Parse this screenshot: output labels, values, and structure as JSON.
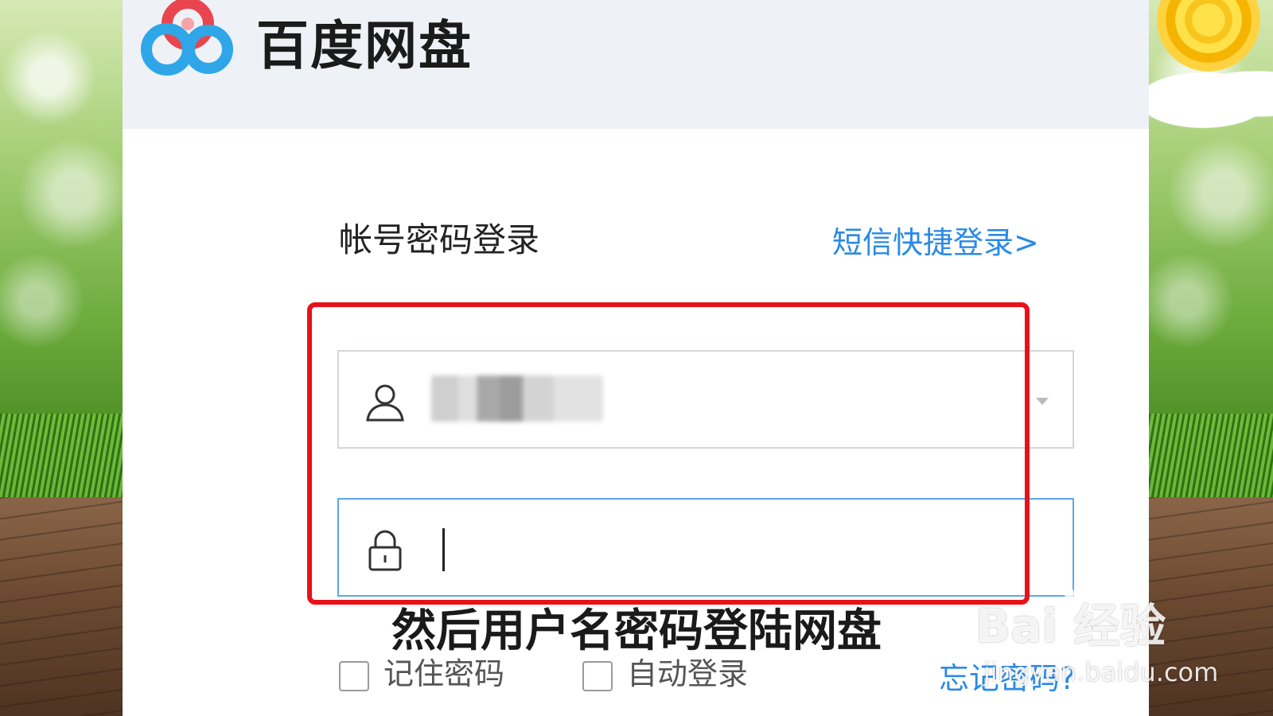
{
  "app": {
    "name": "百度网盘"
  },
  "login": {
    "title": "帐号密码登录",
    "sms_link": "短信快捷登录>",
    "username_field": {
      "value_redacted": true
    },
    "password_field": {
      "value": ""
    },
    "remember_label": "记住密码",
    "autologin_label": "自动登录",
    "forgot_link": "忘记密码?"
  },
  "annotation": {
    "subtitle": "然后用户名密码登陆网盘",
    "highlight_color": "#e8111a"
  },
  "watermark": {
    "brand": "Bai 经验",
    "url": "jingyan.baidu.com"
  },
  "colors": {
    "link": "#2b8ae6",
    "titlebar": "#eef1f6",
    "focus_border": "#5aa8ea"
  },
  "icons": [
    "baidu-netdisk-logo-icon",
    "user-icon",
    "lock-icon",
    "chevron-down-icon",
    "paw-icon"
  ]
}
